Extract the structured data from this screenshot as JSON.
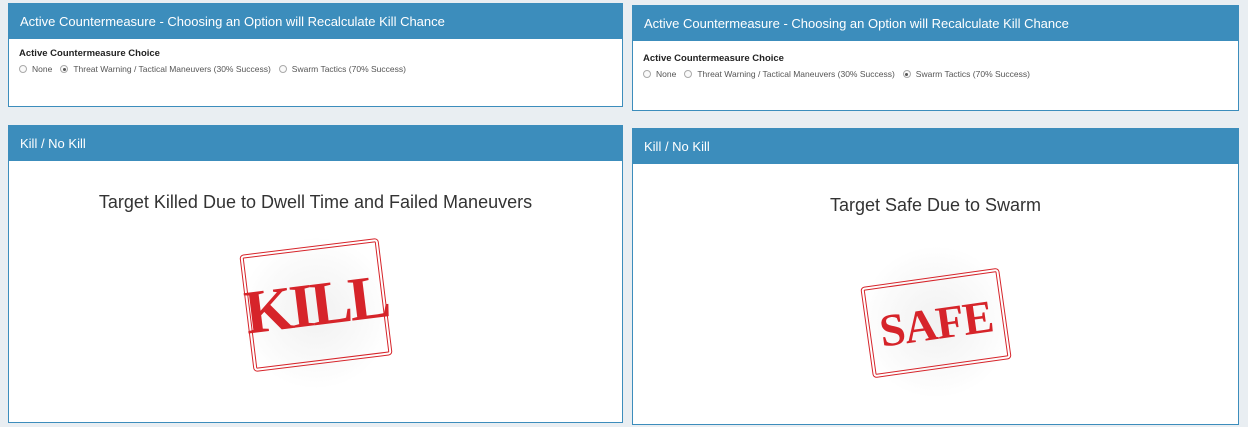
{
  "panels": {
    "countermeasure_left": {
      "header": "Active Countermeasure - Choosing an Option will Recalculate Kill Chance",
      "label": "Active Countermeasure Choice",
      "options": [
        {
          "label": "None",
          "checked": false
        },
        {
          "label": "Threat Warning / Tactical Maneuvers (30% Success)",
          "checked": true
        },
        {
          "label": "Swarm Tactics (70% Success)",
          "checked": false
        }
      ]
    },
    "countermeasure_right": {
      "header": "Active Countermeasure - Choosing an Option will Recalculate Kill Chance",
      "label": "Active Countermeasure Choice",
      "options": [
        {
          "label": "None",
          "checked": false
        },
        {
          "label": "Threat Warning / Tactical Maneuvers (30% Success)",
          "checked": false
        },
        {
          "label": "Swarm Tactics (70% Success)",
          "checked": true
        }
      ]
    },
    "result_left": {
      "header": "Kill / No Kill",
      "message": "Target Killed Due to Dwell Time and Failed Maneuvers",
      "stamp": "KILL",
      "stamp_color": "#d6242a"
    },
    "result_right": {
      "header": "Kill / No Kill",
      "message": "Target Safe Due to Swarm",
      "stamp": "SAFE",
      "stamp_color": "#d6242a"
    }
  },
  "colors": {
    "header_bg": "#3c8dbc",
    "page_bg": "#e9eef2"
  }
}
